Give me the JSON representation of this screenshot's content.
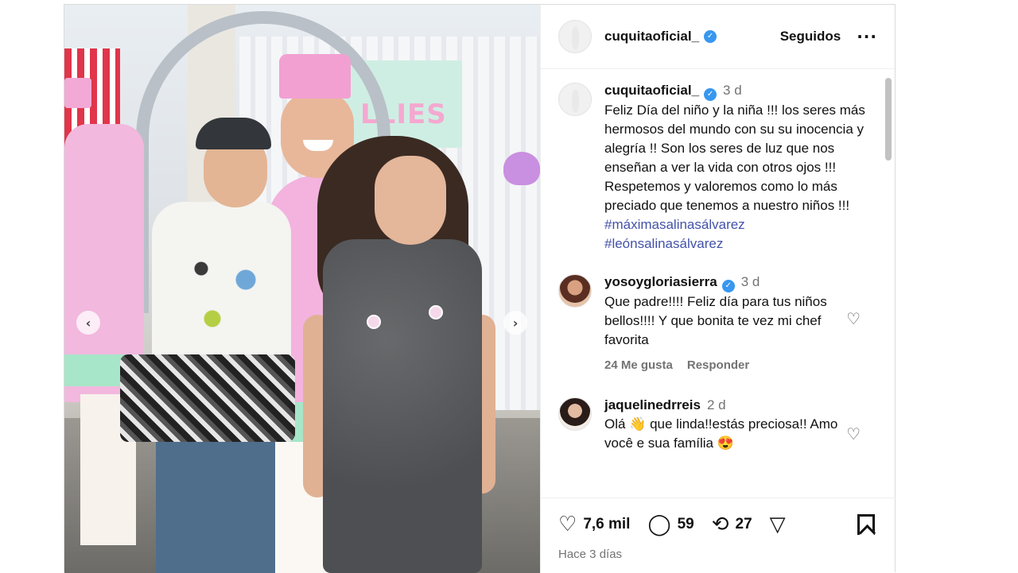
{
  "post": {
    "header": {
      "username": "cuquitaoficial_",
      "follow_label": "Seguidos",
      "more_icon": "more-options-icon"
    },
    "media": {
      "sign_text": "LLIES",
      "prev_arrow": "‹",
      "next_arrow": "›"
    },
    "caption": {
      "username": "cuquitaoficial_",
      "time": "3 d",
      "text": "Feliz Día del niño y la niña !!! los seres más hermosos del mundo con su su inocencia y alegría !! Son los seres de luz que nos enseñan a ver la vida con otros ojos !!!\nRespetemos y valoremos como lo más preciado que tenemos  a nuestro niños !!! ",
      "hashtags": [
        "#máximasalinasálvarez",
        "#leónsalinasálvarez"
      ]
    },
    "comments": [
      {
        "username": "yosoygloriasierra",
        "verified": true,
        "time": "3 d",
        "text": "Que padre!!!! Feliz día para tus niños bellos!!!! Y que bonita te vez mi chef favorita",
        "likes": "24 Me gusta",
        "reply_label": "Responder"
      },
      {
        "username": "jaquelinedrreis",
        "verified": false,
        "time": "2 d",
        "text": "Olá 👋 que linda!!estás preciosa!! Amo você e sua família 😍"
      }
    ],
    "actions": {
      "likes": "7,6 mil",
      "comments": "59",
      "reposts": "27",
      "date": "Hace 3 días"
    },
    "colors": {
      "verified": "#3897f0",
      "hashtag": "#4352a8",
      "muted": "#737373"
    }
  }
}
